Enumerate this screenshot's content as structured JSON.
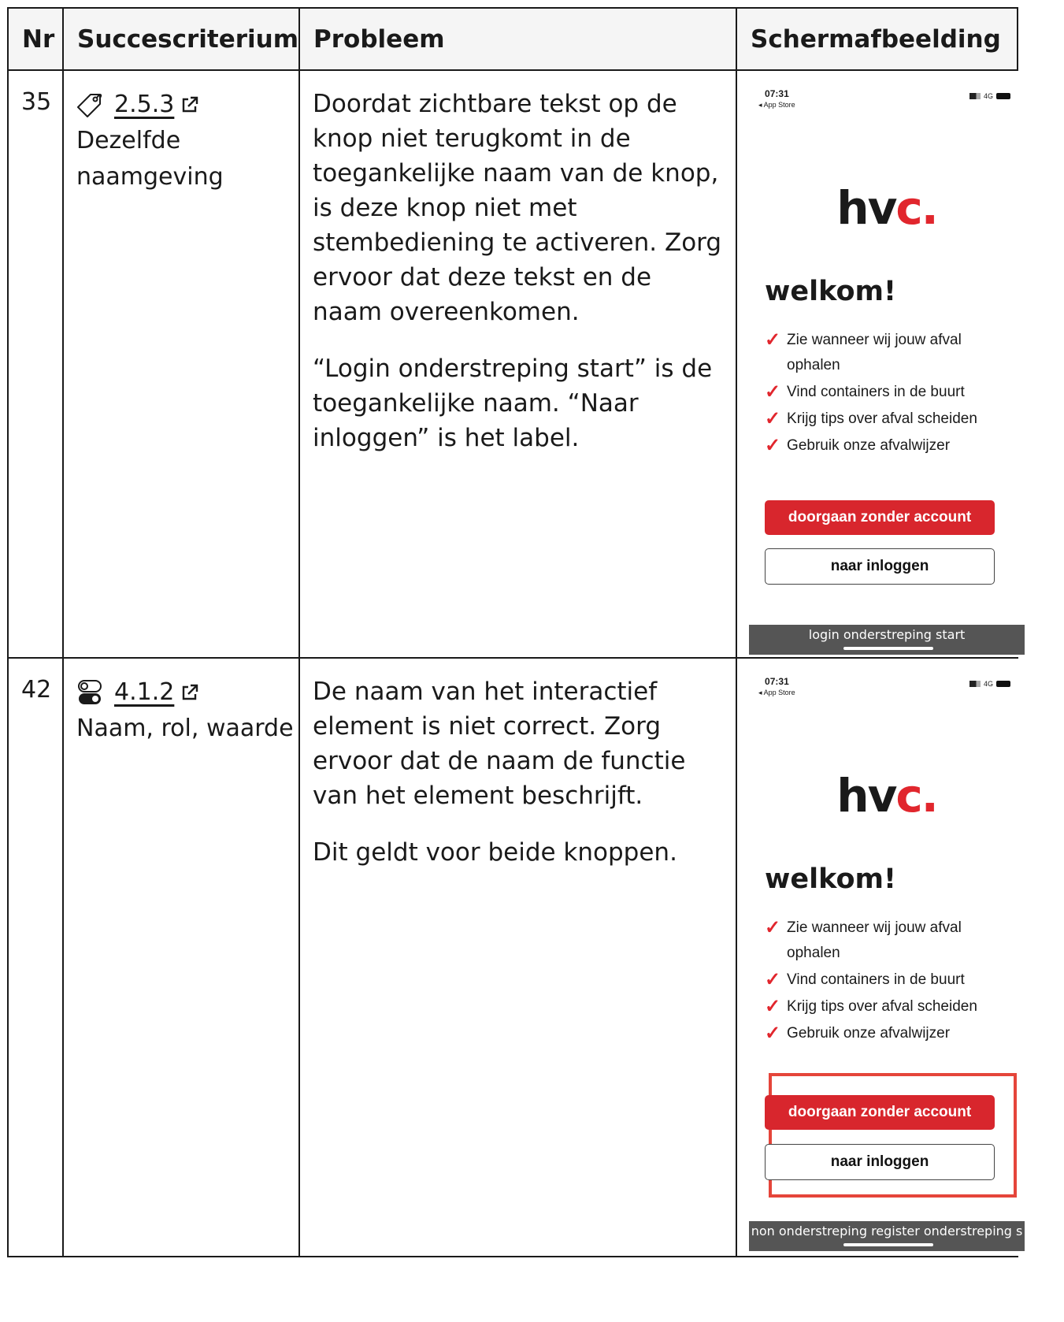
{
  "headers": {
    "nr": "Nr",
    "criterion": "Succescriterium",
    "problem": "Probleem",
    "screenshot": "Schermafbeelding"
  },
  "rows": [
    {
      "nr": "35",
      "criterion_code": "2.5.3",
      "criterion_name": "Dezelfde naamgeving",
      "criterion_icon": "tag-icon",
      "problem": [
        "Doordat zichtbare tekst op de knop niet terugkomt in de toegankelijke naam van de knop, is deze knop niet met stembediening te activeren. Zorg ervoor dat deze tekst en de naam overeenkomen.",
        "“Login onderstreping start” is de toegankelijke naam. “Naar inloggen” is het label."
      ],
      "phone": {
        "time": "07:31",
        "back": "◂ App Store",
        "network": "4G",
        "logo_main": "hv",
        "logo_accent": "c.",
        "welcome": "welkom!",
        "features": [
          "Zie wanneer wij jouw afval ophalen",
          "Vind containers in de buurt",
          "Krijg tips over afval scheiden",
          "Gebruik onze afvalwijzer"
        ],
        "primary_button": "doorgaan zonder account",
        "secondary_button": "naar inloggen",
        "voice_overlay": "login onderstreping start"
      }
    },
    {
      "nr": "42",
      "criterion_code": "4.1.2",
      "criterion_name": "Naam, rol, waarde",
      "criterion_icon": "toggle-icon",
      "problem": [
        "De naam van het interactief element is niet correct. Zorg ervoor dat de naam de functie van het element beschrijft.",
        "Dit geldt voor beide knoppen."
      ],
      "phone": {
        "time": "07:31",
        "back": "◂ App Store",
        "network": "4G",
        "logo_main": "hv",
        "logo_accent": "c.",
        "welcome": "welkom!",
        "features": [
          "Zie wanneer wij jouw afval ophalen",
          "Vind containers in de buurt",
          "Krijg tips over afval scheiden",
          "Gebruik onze afvalwijzer"
        ],
        "primary_button": "doorgaan zonder account",
        "secondary_button": "naar inloggen",
        "voice_overlay": "non onderstreping register onderstreping s"
      }
    }
  ],
  "colors": {
    "accent_red": "#d8262d",
    "highlight": "#e5453a",
    "overlay": "#555555"
  }
}
